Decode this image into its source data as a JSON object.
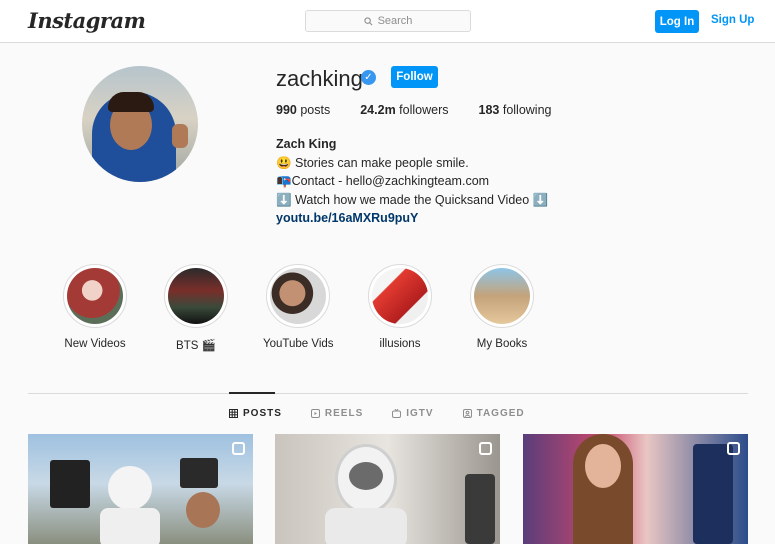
{
  "header": {
    "logo": "Instagram",
    "search_placeholder": "Search",
    "login_label": "Log In",
    "signup_label": "Sign Up"
  },
  "profile": {
    "username": "zachking",
    "follow_label": "Follow",
    "stats": [
      {
        "value": "990",
        "label": "posts"
      },
      {
        "value": "24.2m",
        "label": "followers"
      },
      {
        "value": "183",
        "label": "following"
      }
    ],
    "bio": {
      "name": "Zach King",
      "line1": "😃 Stories can make people smile.",
      "line2": "📭Contact - hello@zachkingteam.com",
      "line3": "⬇️ Watch how we made the Quicksand Video ⬇️",
      "link": "youtu.be/16aMXRu9puY"
    }
  },
  "highlights": [
    {
      "label": "New Videos"
    },
    {
      "label": "BTS 🎬"
    },
    {
      "label": "YouTube Vids"
    },
    {
      "label": "illusions"
    },
    {
      "label": "My Books"
    }
  ],
  "tabs": [
    {
      "label": "POSTS",
      "icon": "grid-icon",
      "active": true
    },
    {
      "label": "REELS",
      "icon": "reels-icon",
      "active": false
    },
    {
      "label": "IGTV",
      "icon": "igtv-icon",
      "active": false
    },
    {
      "label": "TAGGED",
      "icon": "tagged-icon",
      "active": false
    }
  ],
  "colors": {
    "accent": "#0095f6",
    "verified": "#3897f0",
    "link": "#00376b"
  }
}
